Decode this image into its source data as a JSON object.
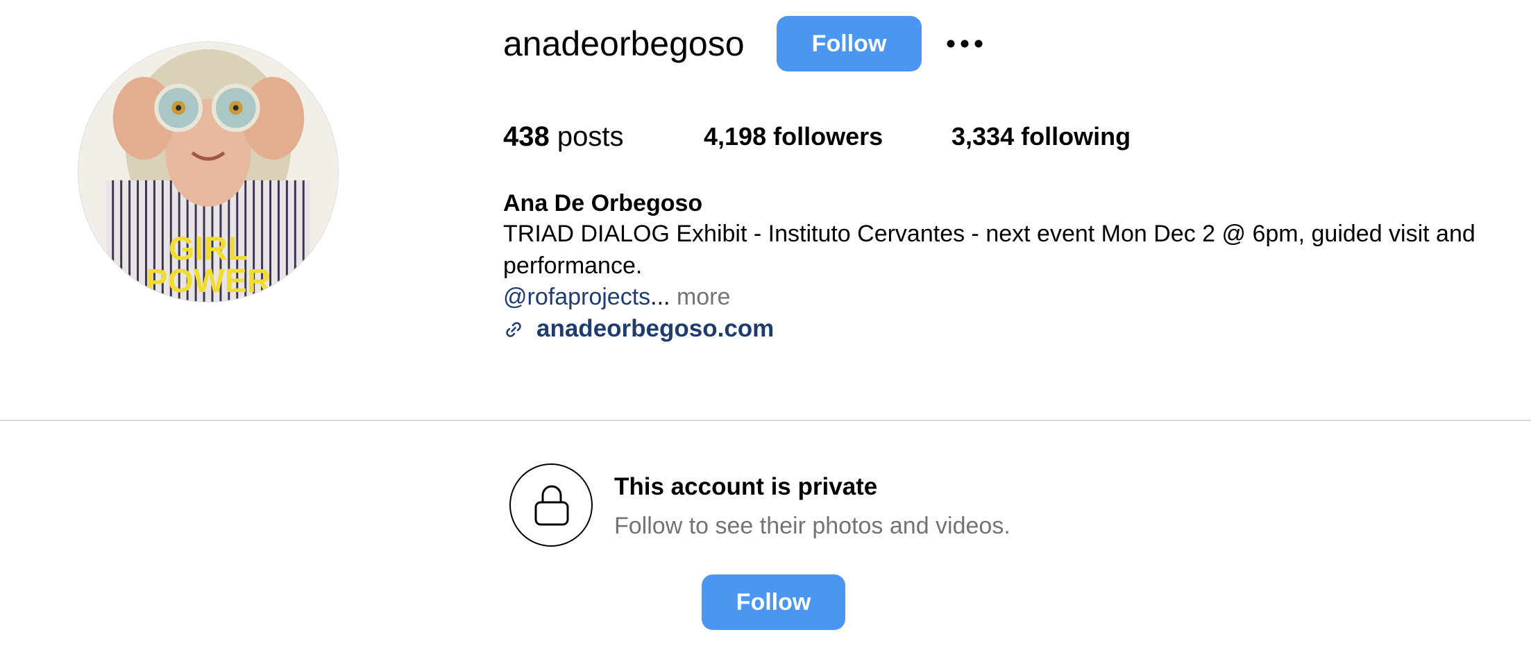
{
  "profile": {
    "username": "anadeorbegoso",
    "follow_label": "Follow",
    "more_options_icon": "ellipsis-icon",
    "avatar_caption": "GIRL POWER"
  },
  "stats": {
    "posts_count": "438",
    "posts_label": "posts",
    "followers_count": "4,198",
    "followers_label": "followers",
    "following_count": "3,334",
    "following_label": "following"
  },
  "bio": {
    "full_name": "Ana De Orbegoso",
    "line1": "TRIAD DIALOG Exhibit - Instituto Cervantes - next event Mon Dec 2 @ 6pm, guided visit and",
    "line2": "performance.",
    "mention": "@rofaprojects",
    "ellipsis": "...",
    "more_label": "more",
    "link_icon": "link-icon",
    "website": "anadeorbegoso.com"
  },
  "private_notice": {
    "icon": "lock-icon",
    "title": "This account is private",
    "subtitle": "Follow to see their photos and videos.",
    "follow_label": "Follow"
  },
  "colors": {
    "button_blue": "#4a96f0",
    "link_navy": "#1f3c6e",
    "muted_gray": "#737373",
    "divider": "#dbdbdb"
  }
}
